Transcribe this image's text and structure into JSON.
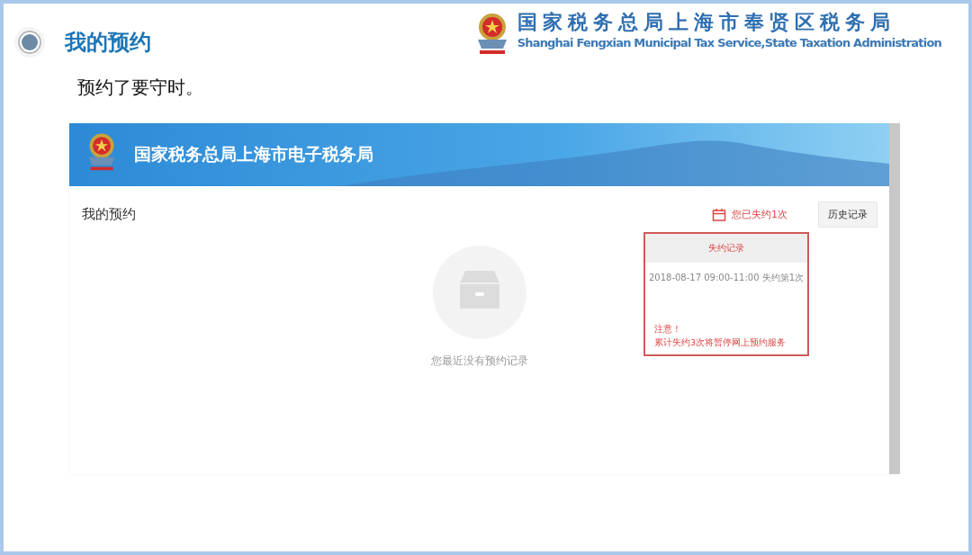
{
  "slide": {
    "title": "我的预约",
    "subtitle": "预约了要守时。",
    "org": {
      "name_zh": "国家税务总局上海市奉贤区税务局",
      "name_en": "Shanghai Fengxian Municipal Tax Service,State Taxation  Administration"
    }
  },
  "screenshot": {
    "banner_title": "国家税务总局上海市电子税务局",
    "page_title": "我的预约",
    "missed_notice": "您已失约1次",
    "history_button": "历史记录",
    "empty_message": "您最近没有预约记录",
    "popup": {
      "title": "失约记录",
      "records": [
        "2018-08-17 09:00-11:00 失约第1次"
      ],
      "note_heading": "注意！",
      "note_text": "累计失约3次将暂停网上预约服务"
    }
  }
}
